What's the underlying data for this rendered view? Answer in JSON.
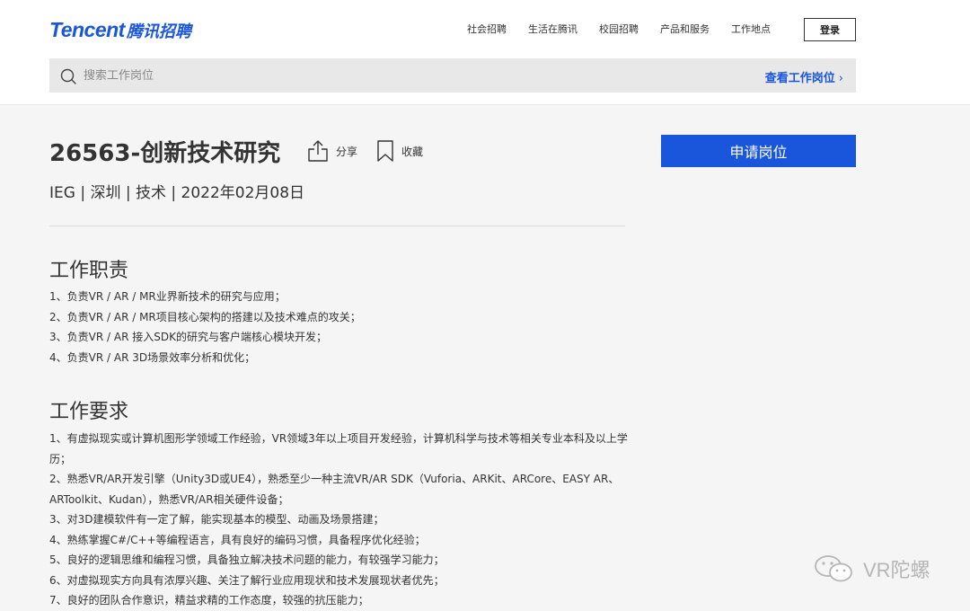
{
  "brand": {
    "logo_en": "Tencent",
    "logo_cn": "腾讯招聘",
    "accent": "#1a56db"
  },
  "nav": {
    "items": [
      "社会招聘",
      "生活在腾讯",
      "校园招聘",
      "产品和服务",
      "工作地点"
    ],
    "login_label": "登录"
  },
  "search": {
    "placeholder": "搜索工作岗位",
    "view_jobs_label": "查看工作岗位",
    "view_jobs_chevron": "›"
  },
  "job": {
    "title": "26563-创新技术研究",
    "share_label": "分享",
    "favorite_label": "收藏",
    "meta": "IEG | 深圳 | 技术 | 2022年02月08日",
    "apply_label": "申请岗位"
  },
  "responsibilities": {
    "title": "工作职责",
    "items": [
      "1、负责VR / AR / MR业界新技术的研究与应用；",
      "2、负责VR / AR / MR项目核心架构的搭建以及技术难点的攻关；",
      "3、负责VR / AR 接入SDK的研究与客户端核心模块开发；",
      "4、负责VR / AR 3D场景效率分析和优化；"
    ]
  },
  "requirements": {
    "title": "工作要求",
    "items": [
      "1、有虚拟现实或计算机图形学领域工作经验，VR领域3年以上项目开发经验，计算机科学与技术等相关专业本科及以上学历；",
      "2、熟悉VR/AR开发引擎（Unity3D或UE4），熟悉至少一种主流VR/AR SDK（Vuforia、ARKit、ARCore、EASY AR、ARToolkit、Kudan），熟悉VR/AR相关硬件设备；",
      "3、对3D建模软件有一定了解，能实现基本的模型、动画及场景搭建；",
      "4、熟练掌握C#/C++等编程语言，具有良好的编码习惯，具备程序优化经验；",
      "5、良好的逻辑思维和编程习惯，具备独立解决技术问题的能力，有较强学习能力；",
      "6、对虚拟现实方向具有浓厚兴趣、关注了解行业应用现状和技术发展现状者优先；",
      "7、良好的团队合作意识，精益求精的工作态度，较强的抗压能力；"
    ]
  },
  "watermark": {
    "text": "VR陀螺",
    "icon": "wechat-icon"
  }
}
